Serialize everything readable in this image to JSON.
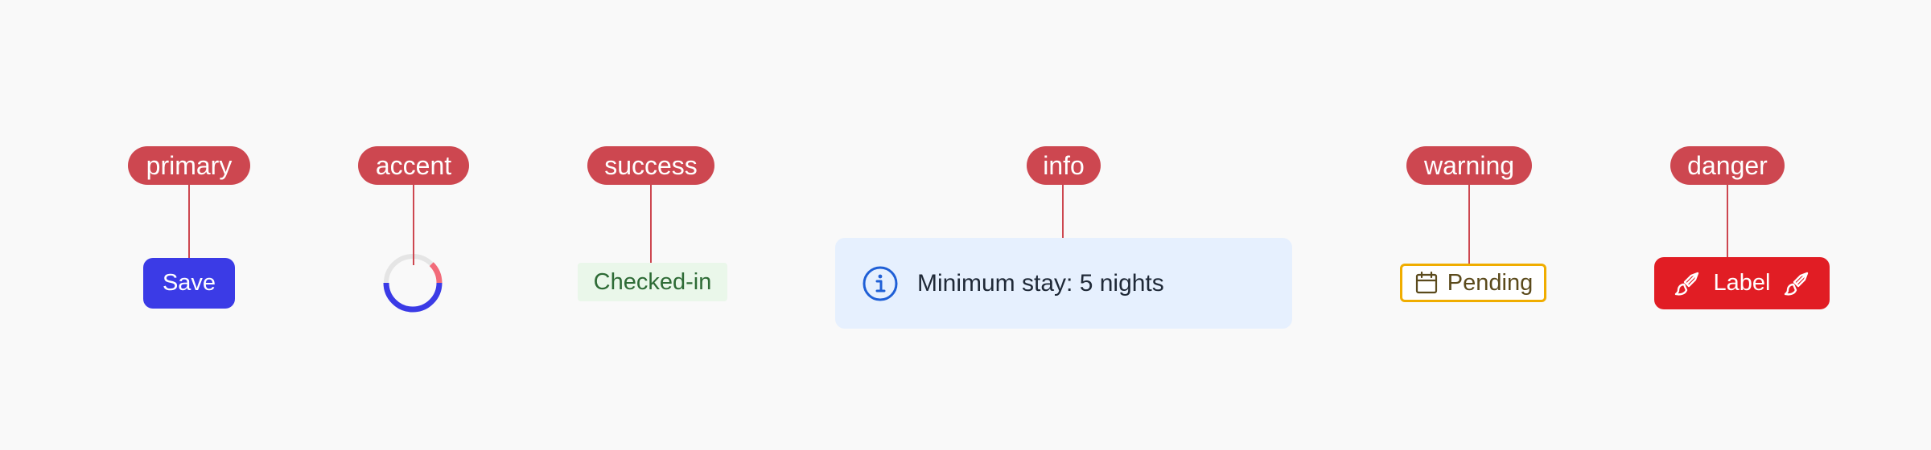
{
  "tags": {
    "primary": "primary",
    "accent": "accent",
    "success": "success",
    "info": "info",
    "warning": "warning",
    "danger": "danger"
  },
  "primary_button": {
    "label": "Save",
    "color": "#3b3be6"
  },
  "accent_spinner": {
    "progress_color": "#3b3be6",
    "accent_color": "#f26b7a",
    "track_color": "#e5e5e5"
  },
  "success_badge": {
    "label": "Checked-in",
    "color": "#2e6b36"
  },
  "info_alert": {
    "message": "Minimum stay: 5 nights",
    "icon": "info-circle-icon",
    "color": "#1f5fd6"
  },
  "warning_chip": {
    "label": "Pending",
    "icon": "calendar-icon",
    "color": "#f0ad00"
  },
  "danger_button": {
    "label": "Label",
    "icon_left": "brush-icon",
    "icon_right": "brush-icon",
    "color": "#e11d24"
  },
  "annotation_color": "#cd4750"
}
